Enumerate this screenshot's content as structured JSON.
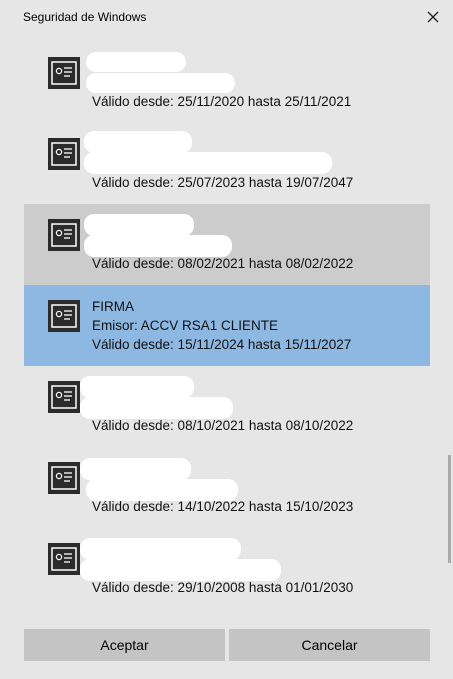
{
  "window": {
    "title": "Seguridad de Windows"
  },
  "certificates": [
    {
      "name": "",
      "issuer": "",
      "validity": "Válido desde: 25/11/2020 hasta 25/11/2021"
    },
    {
      "name": "",
      "issuer": "",
      "validity": "Válido desde: 25/07/2023 hasta 19/07/2047"
    },
    {
      "name": "",
      "issuer": "",
      "validity": "Válido desde: 08/02/2021 hasta 08/02/2022",
      "state": "hover"
    },
    {
      "name": "FIRMA",
      "issuer": "Emisor: ACCV RSA1 CLIENTE",
      "validity": "Válido desde: 15/11/2024 hasta 15/11/2027",
      "state": "selected"
    },
    {
      "name": "",
      "issuer": "",
      "validity": "Válido desde: 08/10/2021 hasta 08/10/2022"
    },
    {
      "name": "",
      "issuer": "",
      "validity": "Válido desde: 14/10/2022 hasta 15/10/2023"
    },
    {
      "name": "",
      "issuer": "",
      "validity": "Válido desde: 29/10/2008 hasta 01/01/2030"
    }
  ],
  "buttons": {
    "accept": "Aceptar",
    "cancel": "Cancelar"
  },
  "colors": {
    "background": "#e6e6e6",
    "hover": "#cccccc",
    "selected": "#8cb8e2",
    "button": "#c4c4c4"
  }
}
